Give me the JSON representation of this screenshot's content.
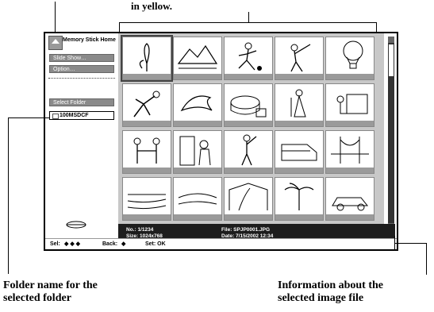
{
  "callouts": {
    "top": "in yellow.",
    "folder_line1": "Folder name for the",
    "folder_line2": "selected folder",
    "info_line1": "Information about the",
    "info_line2": "selected image file"
  },
  "sidebar": {
    "home_title": "Memory Stick Home",
    "slideshow_label": "Slide Show…",
    "option_label": "Option…",
    "select_folder_label": "Select Folder",
    "folder_name": "100MSDCF"
  },
  "info": {
    "no": "No.: 1/1234",
    "size": "Size: 1024x768",
    "file": "File:   SPJP0001.JPG",
    "date": "Date: 7/15/2002 12:34"
  },
  "footer": {
    "sel": "Sel:",
    "back": "Back:",
    "set": "Set: OK"
  },
  "thumbnails": [
    "tulip",
    "mountain-lake",
    "soccer",
    "baseball",
    "balloon",
    "kicker",
    "dolphin",
    "cake",
    "singer",
    "piano",
    "handshake",
    "couple",
    "golf",
    "train",
    "bridge",
    "beach",
    "sea",
    "palm-house",
    "palms",
    "racecar"
  ]
}
